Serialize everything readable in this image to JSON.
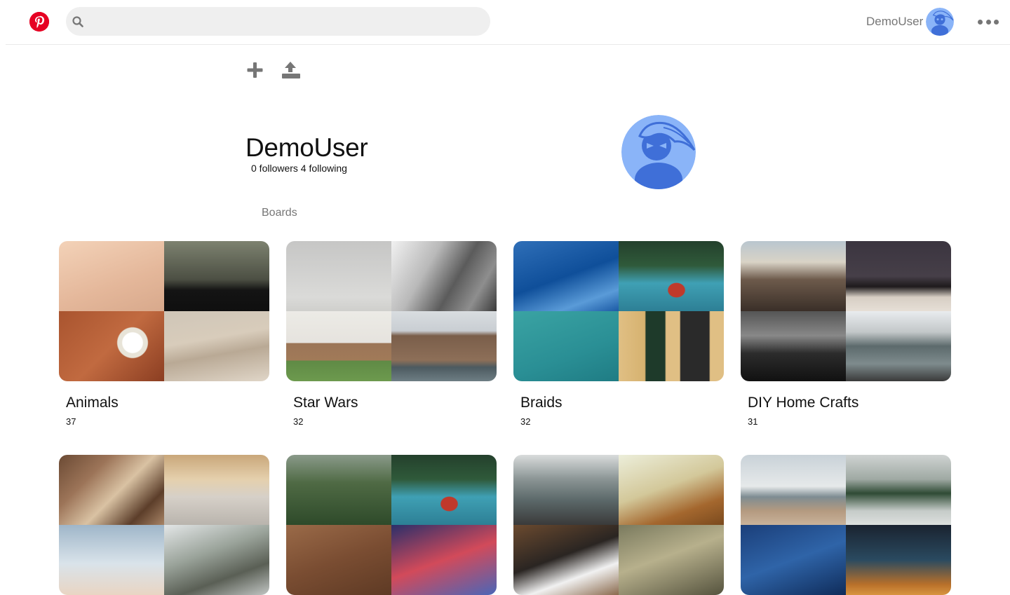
{
  "header": {
    "search_placeholder": "",
    "user_name": "DemoUser",
    "icons": [
      "pinterest-logo",
      "search-icon",
      "avatar",
      "more-icon"
    ]
  },
  "toolbar": {
    "icons": [
      "plus-icon",
      "upload-icon"
    ]
  },
  "profile": {
    "name": "DemoUser",
    "stats": "0 followers 4 following"
  },
  "tabs": {
    "boards": "Boards"
  },
  "boards": [
    {
      "title": "Animals",
      "count": "37"
    },
    {
      "title": "Star Wars",
      "count": "32"
    },
    {
      "title": "Braids",
      "count": "32"
    },
    {
      "title": "DIY Home Crafts",
      "count": "31"
    },
    {
      "title": "",
      "count": ""
    },
    {
      "title": "",
      "count": ""
    },
    {
      "title": "",
      "count": ""
    },
    {
      "title": "",
      "count": ""
    }
  ],
  "colors": {
    "brand": "#e60023",
    "avatar_light": "#8ab4f8",
    "avatar_dark": "#3f6fd8",
    "muted": "#767676"
  }
}
